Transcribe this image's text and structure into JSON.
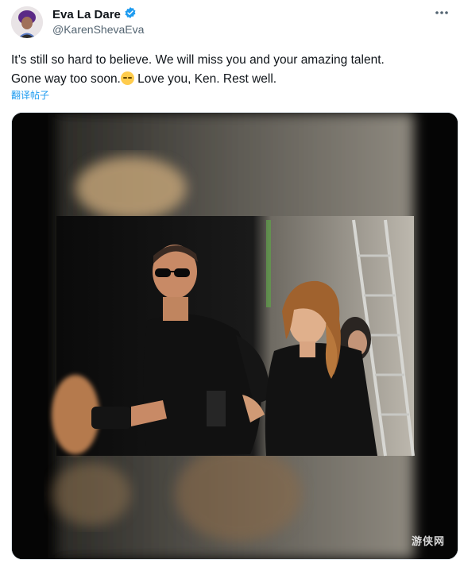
{
  "author": {
    "name": "Eva La Dare",
    "handle": "@KarenShevaEva",
    "verified": true
  },
  "tweet": {
    "line1": "It’s still so hard to believe. We will miss you and your amazing talent.",
    "line2_before_emoji": "Gone way too soon.",
    "line2_after_emoji": " Love you, Ken. Rest well.",
    "emoji": "relieved-face",
    "translate_label": "翻译帖子"
  },
  "media": {
    "type": "photo",
    "description_icon": "photo-two-people-dark-costumes"
  },
  "watermark": "游侠网",
  "colors": {
    "accent": "#1d9bf0",
    "secondary_text": "#536471"
  }
}
